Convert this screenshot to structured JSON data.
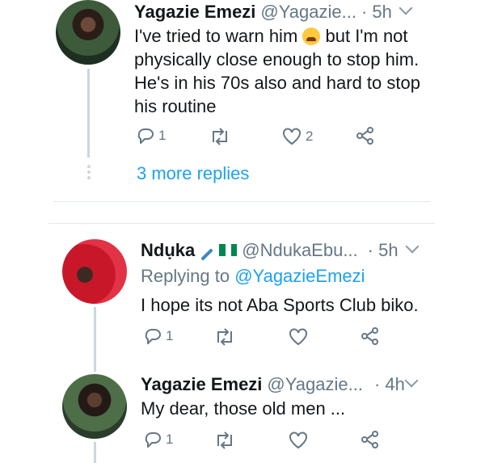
{
  "tweet1": {
    "name": "Yagazie Emezi",
    "handle": "@Yagazie...",
    "time": "· 5h",
    "text_before_emoji": "I've tried to warn him ",
    "text_after_emoji": " but I'm not physically close enough to stop him. He's in his 70s also and hard to stop his routine",
    "emoji": "weary-face-emoji",
    "reply_count": "1",
    "retweet_count": "",
    "like_count": "2",
    "more_replies": "3 more replies"
  },
  "tweet2": {
    "name": "Ndụka",
    "handle": "@NdukaEbu...",
    "time": "· 5h",
    "name_decorations": [
      "pen-emoji",
      "nigeria-flag-emoji"
    ],
    "replying_to_label": "Replying to",
    "replying_to_handle": "@YagazieEmezi",
    "text": "I hope its not Aba Sports Club biko.",
    "reply_count": "1",
    "retweet_count": "",
    "like_count": ""
  },
  "tweet3": {
    "name": "Yagazie Emezi",
    "handle": "@Yagazie...",
    "time": "· 4h",
    "text": "My dear, those old men ...",
    "reply_count": "1",
    "retweet_count": "",
    "like_count": ""
  },
  "colors": {
    "accent": "#1da1f2",
    "muted": "#657786",
    "text": "#14171a",
    "divider": "#e1e8ed",
    "nigeria_green": "#008751"
  }
}
